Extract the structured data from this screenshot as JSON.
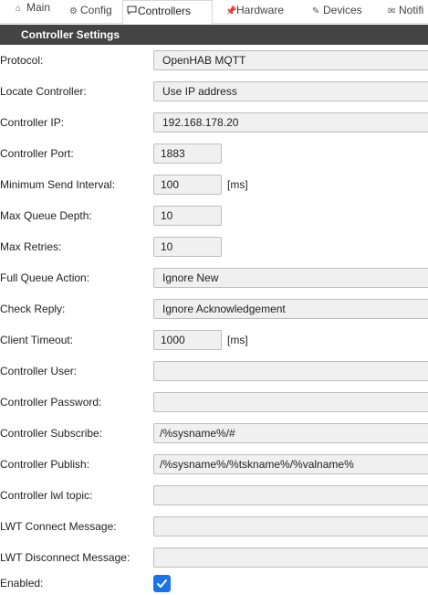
{
  "tabs": [
    {
      "label": "Main",
      "icon": "home-icon"
    },
    {
      "label": "Config",
      "icon": "gear-icon"
    },
    {
      "label": "Controllers",
      "icon": "chat-icon"
    },
    {
      "label": "Hardware",
      "icon": "pin-icon"
    },
    {
      "label": "Devices",
      "icon": "plug-icon"
    },
    {
      "label": "Notifi",
      "icon": "mail-icon"
    }
  ],
  "active_tab": "Controllers",
  "section_title": "Controller Settings",
  "fields": [
    {
      "label": "Protocol:",
      "value": "OpenHAB MQTT"
    },
    {
      "label": "Locate Controller:",
      "value": "Use IP address"
    },
    {
      "label": "Controller IP:",
      "value": "192.168.178.20"
    },
    {
      "label": "Controller Port:",
      "value": "1883"
    },
    {
      "label": "Minimum Send Interval:",
      "value": "100",
      "unit": "[ms]"
    },
    {
      "label": "Max Queue Depth:",
      "value": "10"
    },
    {
      "label": "Max Retries:",
      "value": "10"
    },
    {
      "label": "Full Queue Action:",
      "value": "Ignore New"
    },
    {
      "label": "Check Reply:",
      "value": "Ignore Acknowledgement"
    },
    {
      "label": "Client Timeout:",
      "value": "1000",
      "unit": "[ms]"
    },
    {
      "label": "Controller User:",
      "value": ""
    },
    {
      "label": "Controller Password:",
      "value": ""
    },
    {
      "label": "Controller Subscribe:",
      "value": "/%sysname%/#"
    },
    {
      "label": "Controller Publish:",
      "value": "/%sysname%/%tskname%/%valname%"
    },
    {
      "label": "Controller lwl topic:",
      "value": ""
    },
    {
      "label": "LWT Connect Message:",
      "value": ""
    },
    {
      "label": "LWT Disconnect Message:",
      "value": ""
    },
    {
      "label": "Enabled:",
      "checked": true
    }
  ],
  "colors": {
    "header_bg": "#444444",
    "checkbox": "#1a73e8"
  }
}
